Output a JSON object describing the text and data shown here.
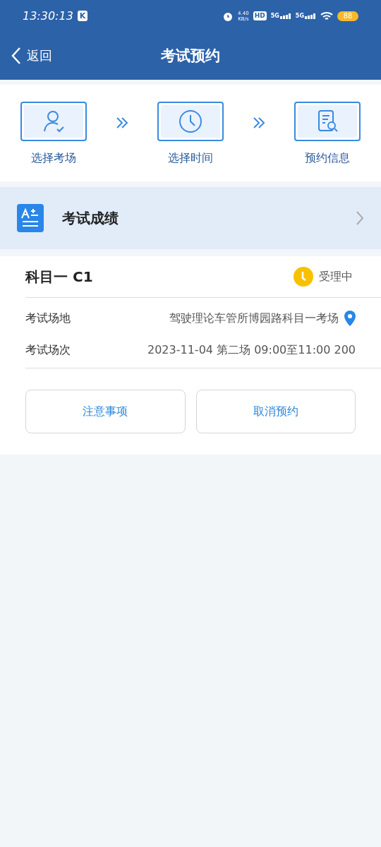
{
  "status_bar": {
    "time": "13:30:13",
    "app_badge": "K",
    "net_speed": "4.40",
    "net_unit": "KB/s",
    "hd": "HD",
    "sims": [
      "5G",
      "5G"
    ],
    "battery": "88"
  },
  "nav": {
    "back": "返回",
    "title": "考试预约"
  },
  "steps": [
    {
      "kind": "person",
      "label": "选择考场"
    },
    {
      "kind": "clock",
      "label": "选择时间"
    },
    {
      "kind": "doc",
      "label": "预约信息"
    }
  ],
  "grade_row": {
    "label": "考试成绩"
  },
  "booking": {
    "subject": "科目一 C1",
    "status": "受理中",
    "fields": [
      {
        "label": "考试场地",
        "value": "驾驶理论车管所博园路科目一考场",
        "pin": true
      },
      {
        "label": "考试场次",
        "value": "2023-11-04 第二场 09:00至11:00 200",
        "pin": false
      }
    ],
    "buttons": [
      "注意事项",
      "取消预约"
    ]
  }
}
